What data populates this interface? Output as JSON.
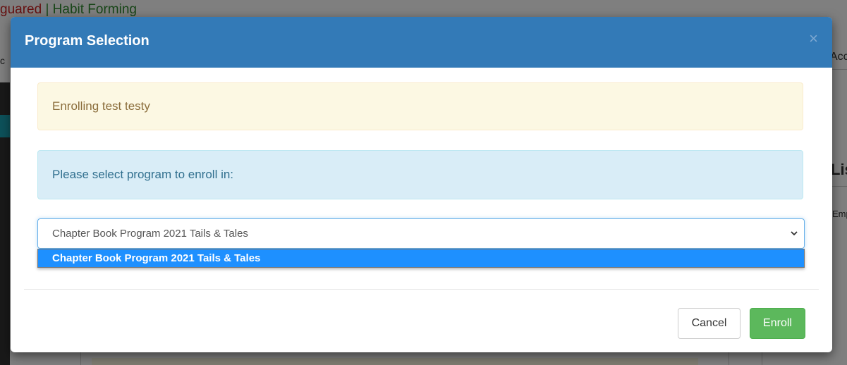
{
  "background": {
    "title_red": "guared",
    "title_green": " | Habit Forming",
    "right_text_1": "Acc",
    "right_text_2": "Lis",
    "right_text_3": "Emp",
    "left_text": "c"
  },
  "modal": {
    "title": "Program Selection",
    "close_symbol": "×",
    "enrolling_message": "Enrolling test testy",
    "instruction": "Please select program to enroll in:",
    "select": {
      "selected_value": "Chapter Book Program 2021 Tails & Tales",
      "options": [
        "Chapter Book Program 2021 Tails & Tales"
      ]
    },
    "buttons": {
      "cancel": "Cancel",
      "enroll": "Enroll"
    }
  },
  "colors": {
    "header": "#337ab7",
    "enroll": "#5cb85c",
    "highlight": "#1e90ff"
  }
}
